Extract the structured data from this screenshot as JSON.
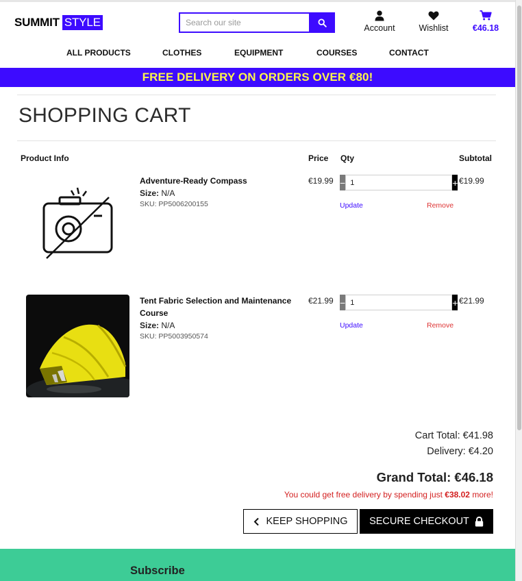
{
  "brand": {
    "part1": "SUMMIT",
    "part2": "STYLE",
    "accent": "#3d0bff",
    "banner_text_color": "#fdf64a",
    "footer_color": "#3dcc96"
  },
  "search": {
    "placeholder": "Search our site",
    "icon": "search-icon"
  },
  "header_links": {
    "account": {
      "label": "Account",
      "icon": "user-icon"
    },
    "wishlist": {
      "label": "Wishlist",
      "icon": "heart-icon"
    },
    "cart": {
      "label": "€46.18",
      "icon": "cart-icon"
    }
  },
  "nav": [
    "ALL PRODUCTS",
    "CLOTHES",
    "EQUIPMENT",
    "COURSES",
    "CONTACT"
  ],
  "banner": "FREE DELIVERY ON ORDERS OVER €80!",
  "page_title": "SHOPPING CART",
  "table_headers": {
    "product": "Product Info",
    "price": "Price",
    "qty": "Qty",
    "subtotal": "Subtotal"
  },
  "items": [
    {
      "name": "Adventure-Ready Compass",
      "size_label": "Size:",
      "size": "N/A",
      "sku": "SKU: PP5006200155",
      "price": "€19.99",
      "qty": "1",
      "update": "Update",
      "remove": "Remove",
      "subtotal": "€19.99",
      "image": "no-image-camera-icon"
    },
    {
      "name": "Tent Fabric Selection and Maintenance Course",
      "size_label": "Size:",
      "size": "N/A",
      "sku": "SKU: PP5003950574",
      "price": "€21.99",
      "qty": "1",
      "update": "Update",
      "remove": "Remove",
      "subtotal": "€21.99",
      "image": "yellow-tent-photo"
    }
  ],
  "totals": {
    "cart_total": "Cart Total: €41.98",
    "delivery": "Delivery: €4.20",
    "grand_total": "Grand Total: €46.18",
    "free_note_prefix": "You could get free delivery by spending just ",
    "free_note_amount": "€38.02",
    "free_note_suffix": " more!"
  },
  "buttons": {
    "keep_shopping": "KEEP SHOPPING",
    "checkout": "SECURE CHECKOUT"
  },
  "footer": {
    "subscribe": "Subscribe"
  }
}
